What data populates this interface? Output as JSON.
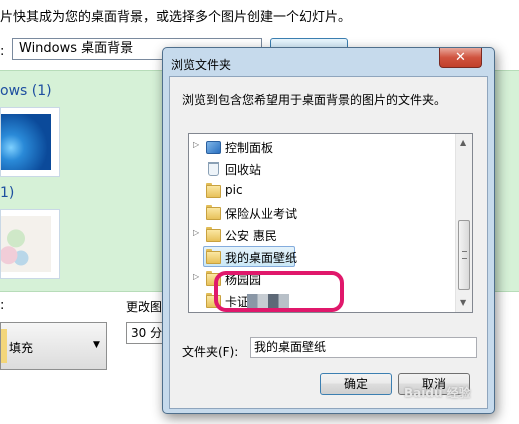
{
  "background_window": {
    "instruction": "片快其成为您的桌面背景，或选择多个图片创建一个幻灯片。",
    "location_label": ":",
    "location_value": "Windows 桌面背景",
    "gallery_groups": [
      {
        "title": "ows (1)"
      },
      {
        "title": "1)"
      }
    ],
    "position_label": ":",
    "position_value": "填充",
    "change_label": "更改图",
    "interval_value": "30 分"
  },
  "dialog": {
    "title": "浏览文件夹",
    "close_glyph": "✕",
    "description": "浏览到包含您希望用于桌面背景的图片的文件夹。",
    "tree_items": [
      {
        "label": "控制面板",
        "icon": "control-panel-icon",
        "expander": "▷"
      },
      {
        "label": "回收站",
        "icon": "recycle-bin-icon",
        "expander": ""
      },
      {
        "label": "pic",
        "icon": "folder-icon",
        "expander": ""
      },
      {
        "label": "保险从业考试",
        "icon": "folder-icon",
        "expander": ""
      },
      {
        "label": "公安 惠民",
        "icon": "folder-icon",
        "expander": "▷"
      },
      {
        "label": "我的桌面壁纸",
        "icon": "folder-icon",
        "expander": "",
        "selected": true
      },
      {
        "label": "杨园园",
        "icon": "folder-icon",
        "expander": "▷"
      },
      {
        "label": "卡证",
        "icon": "folder-icon",
        "expander": ""
      }
    ],
    "folder_label": "文件夹(F):",
    "folder_value": "我的桌面壁纸",
    "ok_label": "确定",
    "cancel_label": "取消",
    "scroll_up": "▲",
    "scroll_down": "▼"
  },
  "watermark": "Baidu 经验",
  "colors": {
    "highlight_ring": "#e0186b",
    "gallery_bg": "#d6f1d7",
    "dialog_frame": "#c6daec"
  }
}
